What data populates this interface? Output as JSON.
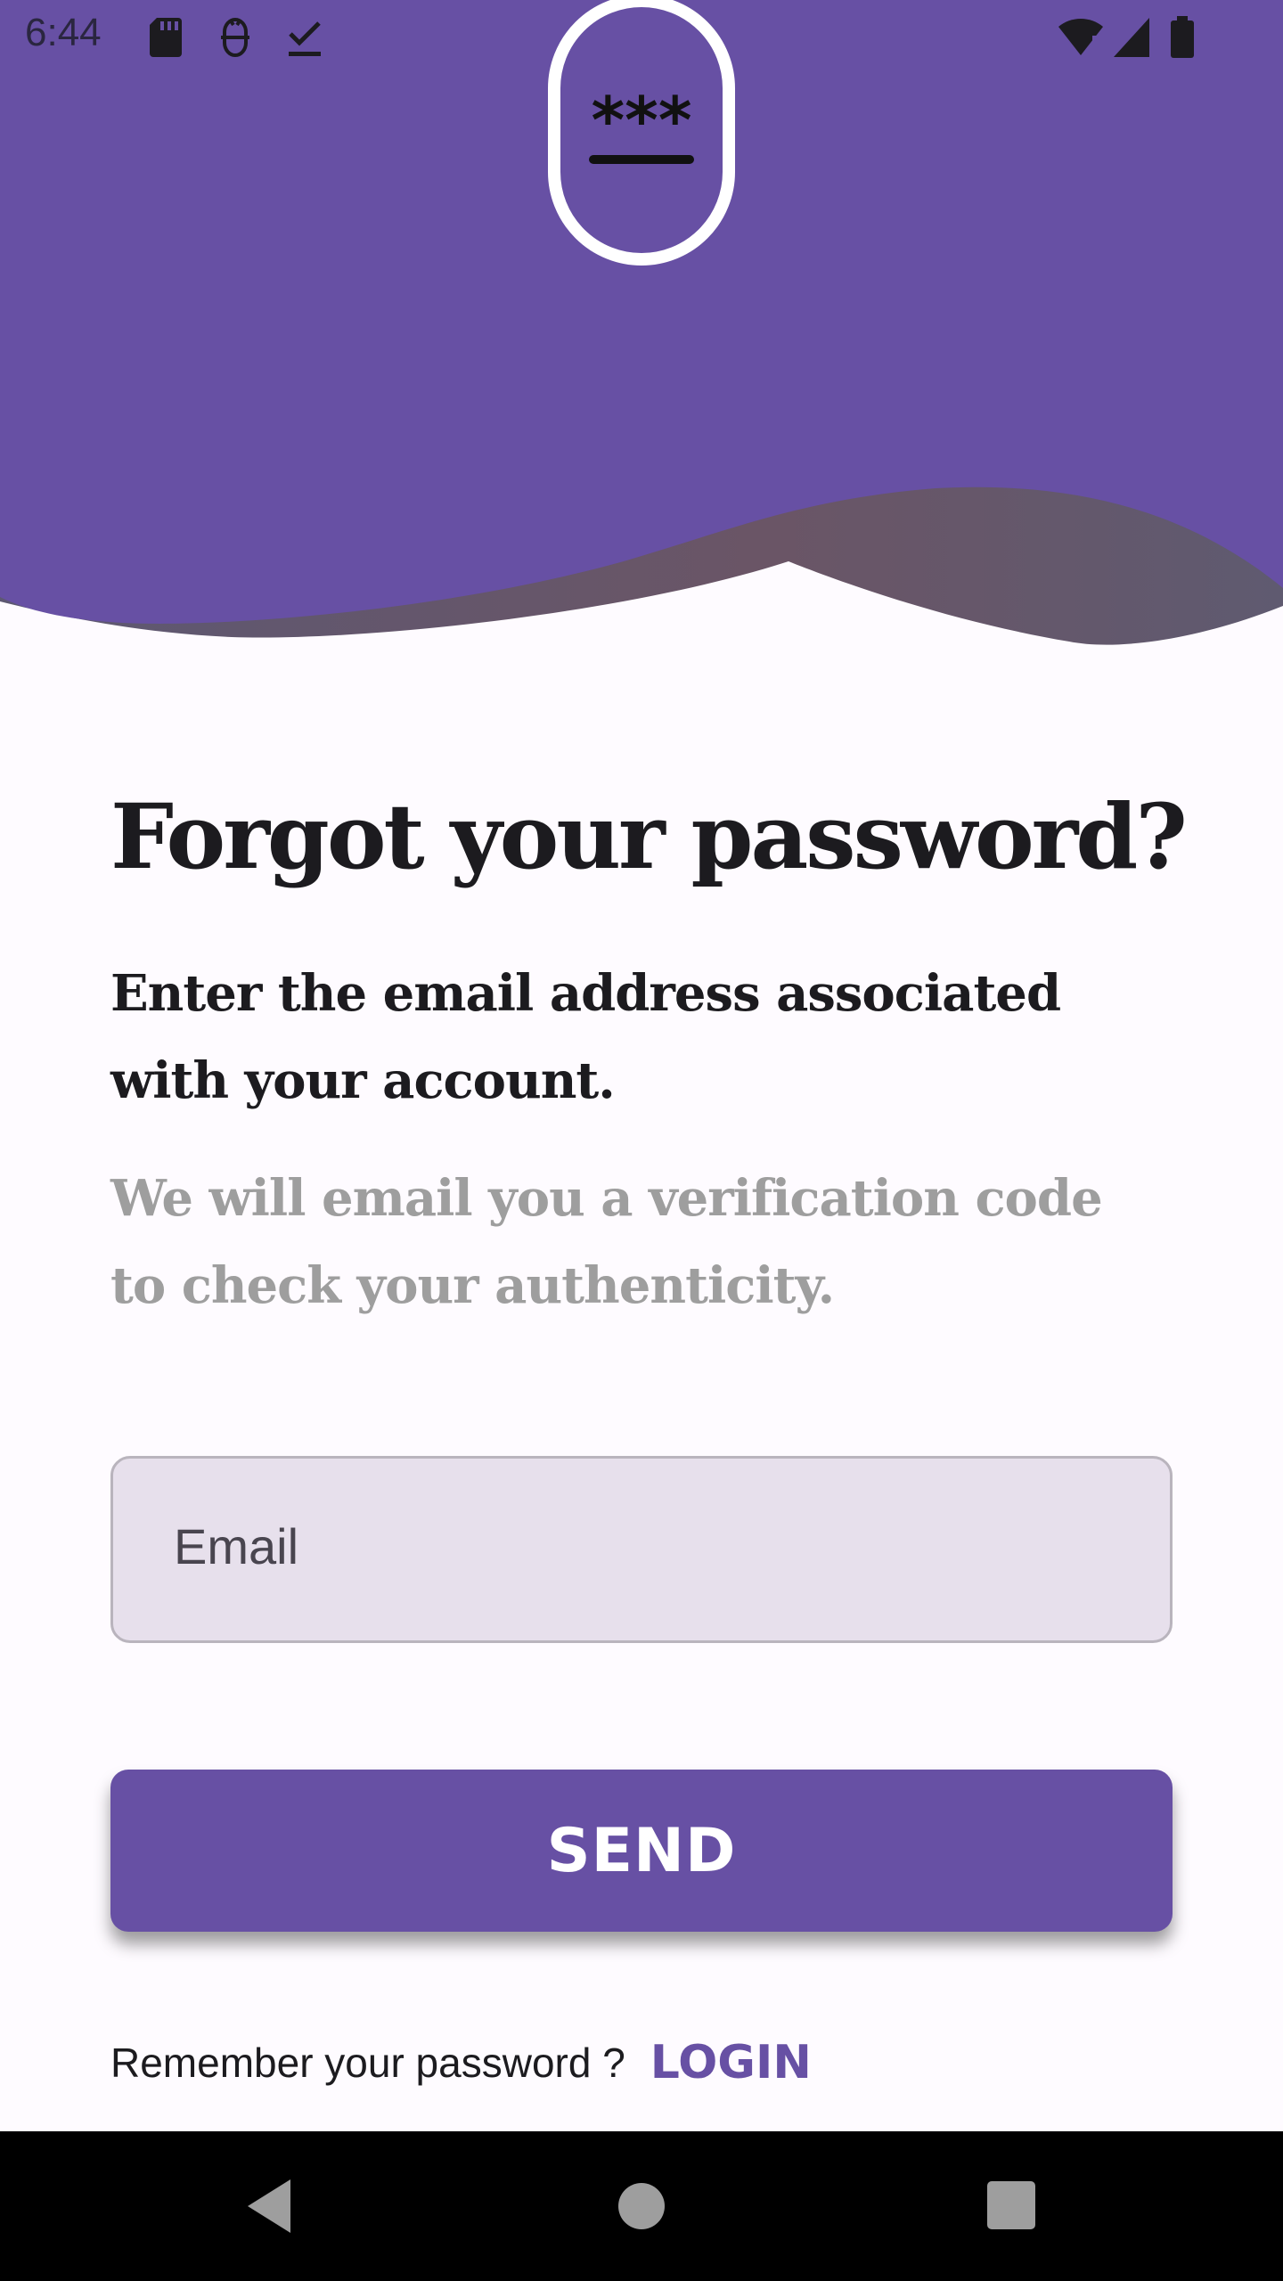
{
  "status_bar": {
    "time": "6:44",
    "icons": [
      "sd-card-icon",
      "hedgehog-icon",
      "download-done-icon",
      "wifi-icon",
      "signal-icon",
      "battery-icon"
    ]
  },
  "header": {
    "badge_text": "***",
    "colors": {
      "primary": "#6750a4",
      "wave": "#5f566d"
    }
  },
  "main": {
    "title": "Forgot your password?",
    "subtitle": "Enter the email address associated with your account.",
    "note": "We will email you a verification code to check your authenticity."
  },
  "form": {
    "email_placeholder": "Email",
    "send_label": "SEND"
  },
  "footer": {
    "prompt": "Remember your password ?",
    "login_label": "LOGIN"
  },
  "nav": {
    "icons": [
      "back-icon",
      "home-icon",
      "recents-icon"
    ]
  }
}
